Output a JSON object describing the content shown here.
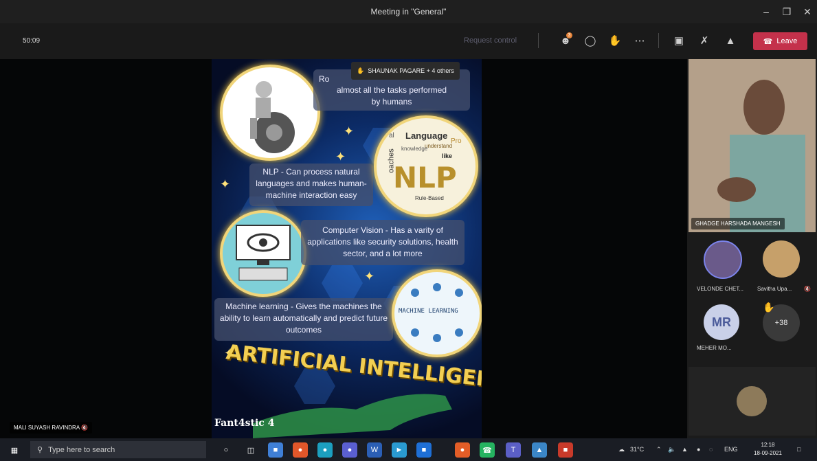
{
  "window": {
    "title": "Meeting in \"General\""
  },
  "toolbar": {
    "timer": "50:09",
    "request_control": "Request control",
    "participant_count": "3",
    "leave_label": "Leave"
  },
  "slide": {
    "raised_hands": "SHAUNAK PAGARE + 4 others",
    "robotics_caption_prefix": "Ro",
    "robotics_caption": "almost all the tasks performed by humans",
    "nlp_caption": "NLP - Can process natural languages and makes human-machine interaction easy",
    "nlp_badge": "NLP",
    "nlp_cloud": [
      "Language",
      "understand",
      "knowledge",
      "like",
      "Rule-Based",
      "Pro",
      "oaches",
      "al"
    ],
    "cv_caption": "Computer Vision - Has a varity of applications like security solutions, health sector, and a lot more",
    "ml_caption": "Machine learning - Gives the machines the ability to learn automatically and predict future outcomes",
    "ml_badge": "MACHINE LEARNING",
    "heading": "ARTIFICIAL INTELLIGENCE",
    "brand": "Fant4stic 4"
  },
  "participants": {
    "main_speaker": "GHADGE HARSHADA MANGESH",
    "p1": "VELONDE CHET...",
    "p2": "Savitha Upa...",
    "p3_initials": "MR",
    "p3": "MEHER MO...",
    "more": "+38",
    "presenter": "MALI SUYASH RAVINDRA"
  },
  "taskbar": {
    "search_placeholder": "Type here to search",
    "weather": "31°C",
    "lang": "ENG",
    "time": "12:18",
    "date": "18-09-2021"
  },
  "colors": {
    "leave": "#c4314b",
    "accent_gold": "#f3cf52",
    "slide_blue": "#1f5fb8"
  }
}
